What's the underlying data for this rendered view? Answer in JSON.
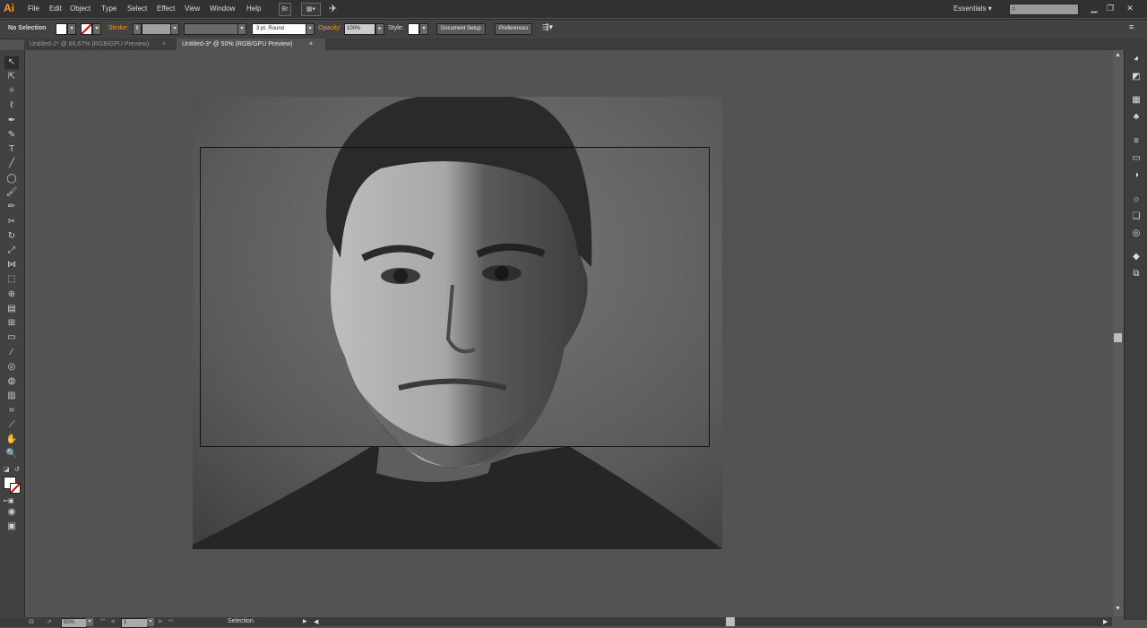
{
  "app": {
    "logo": "Ai"
  },
  "menu": [
    "File",
    "Edit",
    "Object",
    "Type",
    "Select",
    "Effect",
    "View",
    "Window",
    "Help"
  ],
  "bridge_label": "Br",
  "workspace": "Essentials",
  "control": {
    "selection_status": "No Selection",
    "stroke_label": "Stroke:",
    "brush_label": "3 pt. Round",
    "opacity_label": "Opacity:",
    "opacity_value": "100%",
    "style_label": "Style:",
    "document_setup": "Document Setup",
    "preferences": "Preferences"
  },
  "tabs": [
    {
      "label": "Untitled-2* @ 66,67% (RGB/GPU Preview)",
      "close": "×"
    },
    {
      "label": "Untitled-3* @ 50% (RGB/GPU Preview)",
      "close": "×"
    }
  ],
  "status": {
    "zoom": "50%",
    "artboard_number": "1",
    "tool_name": "Selection"
  },
  "colors": {
    "accent": "#f29a2a",
    "logo": "#ff9a00"
  }
}
